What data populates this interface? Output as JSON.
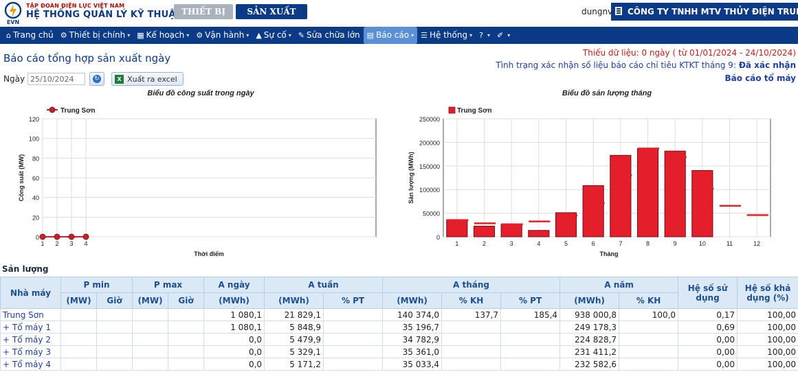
{
  "header": {
    "org": "TẬP ĐOÀN ĐIỆN LỰC VIỆT NAM",
    "logo_text": "EVN",
    "system_title": "HỆ THỐNG QUẢN LÝ KỸ THUẬT",
    "tab_device": "THIẾT BỊ",
    "tab_production": "SẢN XUẤT ĐIỆN",
    "username": "dungnv",
    "company": "CÔNG TY TNHH MTV THỦY ĐIỆN TRUNG SƠN"
  },
  "nav": [
    {
      "label": "Trang chủ",
      "icon": "home-icon",
      "glyph": "⌂"
    },
    {
      "label": "Thiết bị chính",
      "icon": "gears-icon",
      "glyph": "⚙",
      "caret": "▾"
    },
    {
      "label": "Kế hoạch",
      "icon": "calendar-icon",
      "glyph": "▦",
      "caret": "▾"
    },
    {
      "label": "Vận hành",
      "icon": "cogs-icon",
      "glyph": "⚙",
      "caret": "▾"
    },
    {
      "label": "Sự cố",
      "icon": "warning-icon",
      "glyph": "▲",
      "caret": "▾"
    },
    {
      "label": "Sửa chữa lớn",
      "icon": "wrench-icon",
      "glyph": "✎"
    },
    {
      "label": "Báo cáo",
      "icon": "chart-icon",
      "glyph": "▤",
      "caret": "▾",
      "active": true
    },
    {
      "label": "Hệ thống",
      "icon": "list-icon",
      "glyph": "☰",
      "caret": "▾"
    },
    {
      "label": "",
      "icon": "help-icon",
      "glyph": "?",
      "caret": "▾"
    },
    {
      "label": "",
      "icon": "brush-icon",
      "glyph": "✐",
      "caret": "▾"
    }
  ],
  "page": {
    "title": "Báo cáo tổng hợp sản xuất ngày",
    "missing_data": "Thiếu dữ liệu: 0 ngày ( từ 01/01/2024 - 24/10/2024)",
    "confirm_status_label": "Tình trạng xác nhận số liệu báo cáo chỉ tiêu KTKT tháng 9:",
    "confirm_status_value": "Đã xác nhận",
    "machine_report_link": "Báo cáo tổ máy",
    "date_label": "Ngày",
    "date_value": "25/10/2024",
    "export_label": "Xuất ra excel"
  },
  "charts": [
    {
      "type": "line",
      "title": "Biểu đồ công suất trong ngày",
      "xlabel": "Thời điểm",
      "ylabel": "Công suất (MW)",
      "ylim": [
        0,
        120
      ],
      "yticks": [
        0,
        20,
        40,
        60,
        80,
        100,
        120
      ],
      "x": [
        1,
        2,
        3,
        4
      ],
      "series": [
        {
          "name": "Trung Sơn",
          "values": [
            0,
            0,
            0,
            0
          ],
          "color": "#cc1f2b"
        }
      ],
      "legend": "top-left",
      "grid": true
    },
    {
      "type": "bar",
      "title": "Biểu đồ sản lượng tháng",
      "xlabel": "Tháng",
      "ylabel": "Sản lượng (MWh)",
      "ylim": [
        0,
        250000
      ],
      "yticks": [
        0,
        50000,
        100000,
        150000,
        200000,
        250000
      ],
      "categories": [
        1,
        2,
        3,
        4,
        5,
        6,
        7,
        8,
        9,
        10,
        11,
        12
      ],
      "series": [
        {
          "name": "Trung Sơn",
          "values": [
            36000,
            22500,
            26500,
            13500,
            51000,
            108500,
            172500,
            187000,
            181500,
            140400,
            null,
            null
          ],
          "color": "#e41f2b"
        }
      ],
      "plan_markers": [
        35500,
        28500,
        26500,
        32500,
        45000,
        71500,
        130000,
        187000,
        168500,
        102000,
        65500,
        46000
      ],
      "legend": "top-left",
      "grid": true
    }
  ],
  "table": {
    "section_title": "Sản lượng",
    "headers": {
      "plant": "Nhà máy",
      "pmin": "P min",
      "pmax": "P max",
      "a_day": "A ngày",
      "a_week": "A tuần",
      "a_month": "A tháng",
      "a_year": "A năm",
      "usage": "Hệ số sử dụng",
      "avail": "Hệ số khả dụng (%)"
    },
    "subheaders": {
      "mw": "(MW)",
      "hour": "Giờ",
      "mwh": "(MWh)",
      "pt": "% PT",
      "kh": "% KH"
    },
    "rows": [
      {
        "name": "Trung Sơn",
        "pmin_mw": "",
        "pmin_h": "",
        "pmax_mw": "",
        "pmax_h": "",
        "a_day": "1 080,1",
        "a_week": "21 829,1",
        "a_week_pt": "",
        "a_month": "140 374,0",
        "a_month_kh": "137,7",
        "a_month_pt": "185,4",
        "a_year": "938 000,8",
        "a_year_kh": "100,0",
        "usage": "0,17",
        "avail": "100,00"
      },
      {
        "name": "+ Tổ máy 1",
        "pmin_mw": "",
        "pmin_h": "",
        "pmax_mw": "",
        "pmax_h": "",
        "a_day": "1 080,1",
        "a_week": "5 848,9",
        "a_week_pt": "",
        "a_month": "35 196,7",
        "a_month_kh": "",
        "a_month_pt": "",
        "a_year": "249 178,3",
        "a_year_kh": "",
        "usage": "0,69",
        "avail": "100,00"
      },
      {
        "name": "+ Tổ máy 2",
        "pmin_mw": "",
        "pmin_h": "",
        "pmax_mw": "",
        "pmax_h": "",
        "a_day": "0,0",
        "a_week": "5 479,9",
        "a_week_pt": "",
        "a_month": "34 782,9",
        "a_month_kh": "",
        "a_month_pt": "",
        "a_year": "224 828,7",
        "a_year_kh": "",
        "usage": "0,00",
        "avail": "100,00"
      },
      {
        "name": "+ Tổ máy 3",
        "pmin_mw": "",
        "pmin_h": "",
        "pmax_mw": "",
        "pmax_h": "",
        "a_day": "0,0",
        "a_week": "5 329,1",
        "a_week_pt": "",
        "a_month": "35 361,0",
        "a_month_kh": "",
        "a_month_pt": "",
        "a_year": "231 411,2",
        "a_year_kh": "",
        "usage": "0,00",
        "avail": "100,00"
      },
      {
        "name": "+ Tổ máy 4",
        "pmin_mw": "",
        "pmin_h": "",
        "pmax_mw": "",
        "pmax_h": "",
        "a_day": "0,0",
        "a_week": "5 171,2",
        "a_week_pt": "",
        "a_month": "35 033,4",
        "a_month_kh": "",
        "a_month_pt": "",
        "a_year": "232 582,6",
        "a_year_kh": "",
        "usage": "0,00",
        "avail": "100,00"
      }
    ]
  }
}
